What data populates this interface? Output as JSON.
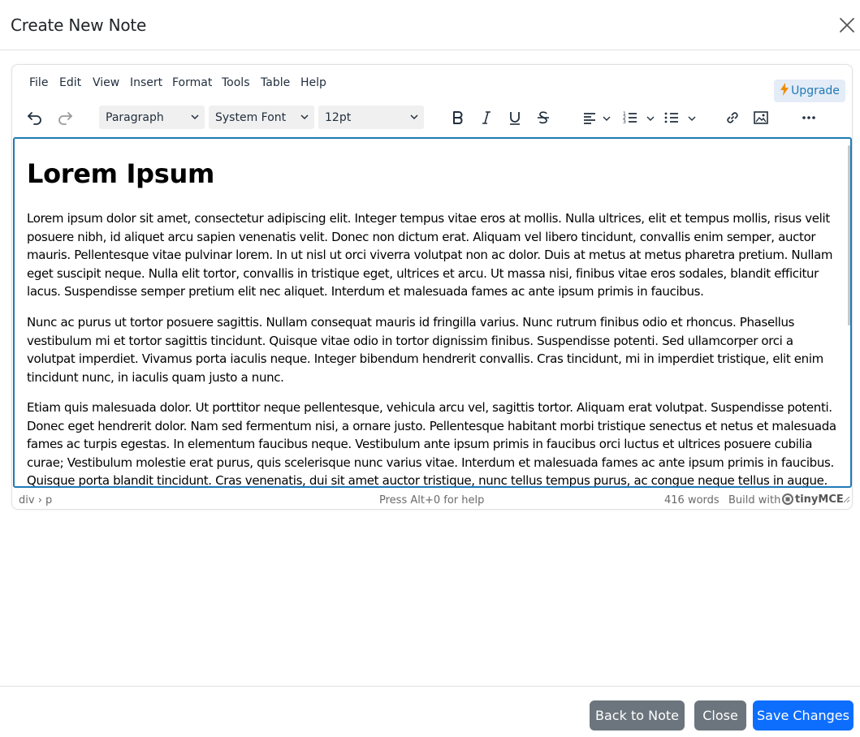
{
  "modal": {
    "title": "Create New Note"
  },
  "menubar": {
    "items": [
      "File",
      "Edit",
      "View",
      "Insert",
      "Format",
      "Tools",
      "Table",
      "Help"
    ],
    "upgrade_label": "Upgrade"
  },
  "toolbar": {
    "block_format": "Paragraph",
    "font_family": "System Font",
    "font_size": "12pt",
    "icons": [
      "undo-icon",
      "redo-icon",
      "bold-icon",
      "italic-icon",
      "underline-icon",
      "strikethrough-icon",
      "align-left-icon",
      "numbered-list-icon",
      "bullet-list-icon",
      "link-icon",
      "image-icon",
      "more-icon"
    ]
  },
  "content": {
    "heading": "Lorem Ipsum",
    "paragraphs": [
      "Lorem ipsum dolor sit amet, consectetur adipiscing elit. Integer tempus vitae eros at mollis. Nulla ultrices, elit et tempus mollis, risus velit posuere nibh, id aliquet arcu sapien venenatis velit. Donec non dictum erat. Aliquam vel libero tincidunt, convallis enim semper, auctor mauris. Pellentesque vitae pulvinar lorem. In ut nisl ut orci viverra volutpat non ac dolor. Duis at metus at metus pharetra pretium. Nullam eget suscipit neque. Nulla elit tortor, convallis in tristique eget, ultrices et arcu. Ut massa nisi, finibus vitae eros sodales, blandit efficitur lacus. Suspendisse semper pretium elit nec aliquet. Interdum et malesuada fames ac ante ipsum primis in faucibus.",
      "Nunc ac purus ut tortor posuere sagittis. Nullam consequat mauris id fringilla varius. Nunc rutrum finibus odio et rhoncus. Phasellus vestibulum mi et tortor sagittis tincidunt. Quisque vitae odio in tortor dignissim finibus. Suspendisse potenti. Sed ullamcorper orci a volutpat imperdiet. Vivamus porta iaculis neque. Integer bibendum hendrerit convallis. Cras tincidunt, mi in imperdiet tristique, elit enim tincidunt nunc, in iaculis quam justo a nunc.",
      "Etiam quis malesuada dolor. Ut porttitor neque pellentesque, vehicula arcu vel, sagittis tortor. Aliquam erat volutpat. Suspendisse potenti. Donec eget hendrerit dolor. Nam sed fermentum nisi, a ornare justo. Pellentesque habitant morbi tristique senectus et netus et malesuada fames ac turpis egestas. In elementum faucibus neque. Vestibulum ante ipsum primis in faucibus orci luctus et ultrices posuere cubilia curae; Vestibulum molestie erat purus, quis scelerisque nunc varius vitae. Interdum et malesuada fames ac ante ipsum primis in faucibus. Quisque porta blandit tincidunt. Cras venenatis, dui sit amet auctor tristique, nunc tellus tempus purus, ac congue neque tellus in augue. Maecenas"
    ]
  },
  "statusbar": {
    "path": "div › p",
    "help": "Press Alt+0 for help",
    "word_count": "416 words",
    "build_with": "Build with",
    "brand": "tinyMCE"
  },
  "footer": {
    "back_label": "Back to Note",
    "close_label": "Close",
    "save_label": "Save Changes"
  },
  "colors": {
    "accent": "#207ab7",
    "primary": "#0d6efd",
    "secondary": "#6c757d"
  }
}
